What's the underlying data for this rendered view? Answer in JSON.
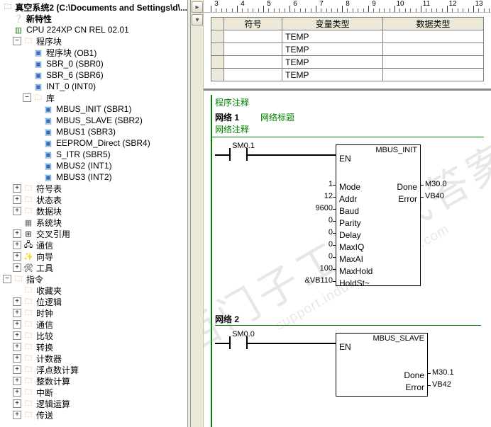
{
  "tree": {
    "project": "真空系统2 (C:\\Documents and Settings\\d\\...",
    "whatsnew": "新特性",
    "cpu": "CPU 224XP CN REL 02.01",
    "progBlocks": "程序块",
    "ob1": "程序块 (OB1)",
    "sbr0": "SBR_0 (SBR0)",
    "sbr6": "SBR_6 (SBR6)",
    "int0": "INT_0 (INT0)",
    "lib": "库",
    "mbusInit": "MBUS_INIT (SBR1)",
    "mbusSlave": "MBUS_SLAVE (SBR2)",
    "mbus1": "MBUS1 (SBR3)",
    "eeprom": "EEPROM_Direct (SBR4)",
    "sitr": "S_ITR (SBR5)",
    "mbus2int": "MBUS2 (INT1)",
    "mbus3int": "MBUS3 (INT2)",
    "symtab": "符号表",
    "stattab": "状态表",
    "datablk": "数据块",
    "sysblk": "系统块",
    "crossref": "交叉引用",
    "comm": "通信",
    "wizard": "向导",
    "tools": "工具",
    "instr": "指令",
    "fav": "收藏夹",
    "bitlogic": "位逻辑",
    "clock": "时钟",
    "comm2": "通信",
    "compare": "比较",
    "convert": "转换",
    "counter": "计数器",
    "floatmath": "浮点数计算",
    "intmath": "整数计算",
    "interrupt": "中断",
    "logicop": "逻辑运算",
    "move": "传送"
  },
  "ruler": {
    "start": 3,
    "end": 13
  },
  "varTable": {
    "headers": [
      "符号",
      "变量类型",
      "数据类型"
    ],
    "rows": [
      {
        "sym": "",
        "type": "TEMP",
        "dtype": ""
      },
      {
        "sym": "",
        "type": "TEMP",
        "dtype": ""
      },
      {
        "sym": "",
        "type": "TEMP",
        "dtype": ""
      },
      {
        "sym": "",
        "type": "TEMP",
        "dtype": ""
      }
    ]
  },
  "program": {
    "comment": "程序注释",
    "net1": {
      "num": "网络 1",
      "title": "网络标题",
      "sub": "网络注释",
      "contact": "SM0.1",
      "fbTitle": "MBUS_INIT",
      "en": "EN",
      "pinsLeft": [
        {
          "ext": "1",
          "name": "Mode"
        },
        {
          "ext": "12",
          "name": "Addr"
        },
        {
          "ext": "9600",
          "name": "Baud"
        },
        {
          "ext": "0",
          "name": "Parity"
        },
        {
          "ext": "0",
          "name": "Delay"
        },
        {
          "ext": "0",
          "name": "MaxIQ"
        },
        {
          "ext": "0",
          "name": "MaxAI"
        },
        {
          "ext": "100",
          "name": "MaxHold"
        },
        {
          "ext": "&VB110",
          "name": "HoldSt~"
        }
      ],
      "pinsRight": [
        {
          "name": "Done",
          "ext": "M30.0"
        },
        {
          "name": "Error",
          "ext": "VB40"
        }
      ]
    },
    "net2": {
      "num": "网络 2",
      "contact": "SM0.0",
      "fbTitle": "MBUS_SLAVE",
      "en": "EN",
      "pinsRight": [
        {
          "name": "Done",
          "ext": "M30.1"
        },
        {
          "name": "Error",
          "ext": "VB42"
        }
      ]
    }
  },
  "watermark": {
    "cn": "西门子工业 找答案",
    "en": "support.industry.siemens.com"
  }
}
